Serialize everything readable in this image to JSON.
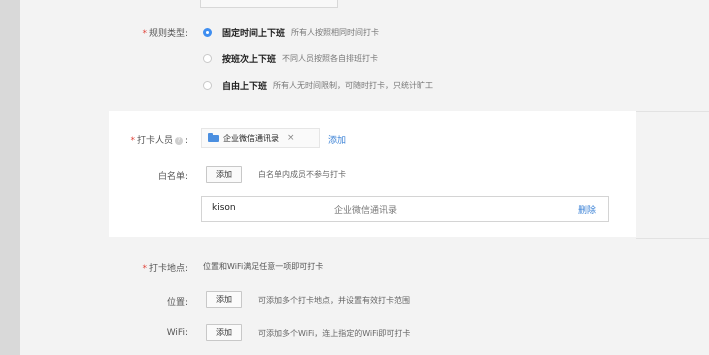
{
  "rule_type": {
    "label": "规则类型:",
    "options": [
      {
        "title": "固定时间上下班",
        "desc": "所有人按照相同时间打卡",
        "selected": true
      },
      {
        "title": "按班次上下班",
        "desc": "不同人员按照各自排班打卡",
        "selected": false
      },
      {
        "title": "自由上下班",
        "desc": "所有人无时间限制，可随时打卡，只统计旷工",
        "selected": false
      }
    ]
  },
  "checkin_members": {
    "label": "打卡人员",
    "label_suffix": ":",
    "info_glyph": "?",
    "tag_icon": "folder-icon",
    "tag_label": "企业微信通讯录",
    "tag_close": "×",
    "add_link": "添加"
  },
  "whitelist": {
    "label": "白名单:",
    "add_button": "添加",
    "hint": "白名单内成员不参与打卡",
    "rows": [
      {
        "name": "kison",
        "dept": "企业微信通讯录",
        "action": "删除"
      }
    ]
  },
  "checkin_location": {
    "label": "打卡地点:",
    "desc": "位置和WiFi满足任意一项即可打卡"
  },
  "location": {
    "label": "位置:",
    "add_button": "添加",
    "hint": "可添加多个打卡地点，并设置有效打卡范围"
  },
  "wifi": {
    "label": "WiFi:",
    "add_button": "添加",
    "hint": "可添加多个WiFi，连上指定的WiFi即可打卡"
  },
  "colors": {
    "accent": "#3f8ef0",
    "required": "#e0443a",
    "link": "#3b82d6"
  }
}
